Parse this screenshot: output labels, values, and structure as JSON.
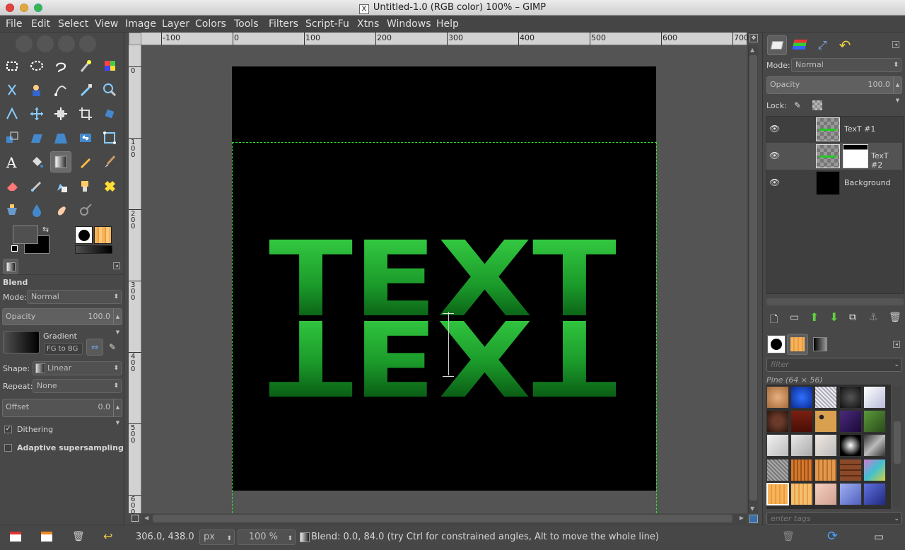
{
  "window": {
    "title": "Untitled-1.0 (RGB color) 100% – GIMP",
    "x_icon_glyph": "X"
  },
  "menu": [
    "File",
    "Edit",
    "Select",
    "View",
    "Image",
    "Layer",
    "Colors",
    "Tools",
    "Filters",
    "Script-Fu",
    "Xtns",
    "Windows",
    "Help"
  ],
  "ruler": {
    "h_labels": [
      "-100",
      "0",
      "100",
      "200",
      "300",
      "400",
      "500",
      "600",
      "700"
    ],
    "v_labels": [
      "0",
      "100",
      "200",
      "300",
      "400",
      "500",
      "600"
    ]
  },
  "toolbox": {
    "tools": [
      "rect-select-icon",
      "ellipse-select-icon",
      "lasso-icon",
      "fuzzy-select-icon",
      "by-color-select-icon",
      "scissors-icon",
      "foreground-select-icon",
      "paths-icon",
      "color-picker-icon",
      "zoom-icon",
      "measure-icon",
      "move-icon",
      "align-icon",
      "crop-icon",
      "rotate-icon",
      "scale-icon",
      "shear-icon",
      "perspective-icon",
      "flip-icon",
      "cage-icon",
      "text-icon",
      "bucket-fill-icon",
      "blend-icon",
      "pencil-icon",
      "paintbrush-icon",
      "eraser-icon",
      "airbrush-icon",
      "ink-icon",
      "clone-icon",
      "heal-icon",
      "perspective-clone-icon",
      "blur-icon",
      "smudge-icon",
      "dodge-burn-icon"
    ],
    "fg_color": "#505050",
    "bg_color": "#000000"
  },
  "tool_options": {
    "title": "Blend",
    "mode_label": "Mode:",
    "mode_value": "Normal",
    "opacity_label": "Opacity",
    "opacity_value": "100.0",
    "gradient_label": "Gradient",
    "gradient_value": "FG to BG",
    "shape_label": "Shape:",
    "shape_value": "Linear",
    "repeat_label": "Repeat:",
    "repeat_value": "None",
    "offset_label": "Offset",
    "offset_value": "0.0",
    "dithering_label": "Dithering",
    "dithering_checked": true,
    "adaptive_label": "Adaptive supersampling",
    "adaptive_checked": false
  },
  "canvas": {
    "text": "TEXT",
    "text_color": "#2ecc40"
  },
  "layers": {
    "mode_label": "Mode:",
    "mode_value": "Normal",
    "opacity_label": "Opacity",
    "opacity_value": "100.0",
    "lock_label": "Lock:",
    "items": [
      {
        "name": "TexT #1",
        "visible": true
      },
      {
        "name": "TexT #2",
        "visible": true
      },
      {
        "name": "Background",
        "visible": true
      }
    ]
  },
  "patterns": {
    "filter_placeholder": "filter",
    "selected_name": "Pine (64 × 56)",
    "tags_placeholder": "enter tags"
  },
  "status": {
    "coords": "306.0, 438.0",
    "unit": "px",
    "zoom": "100 %",
    "message": "Blend: 0.0, 84.0 (try Ctrl for constrained angles, Alt to move the whole line)"
  }
}
